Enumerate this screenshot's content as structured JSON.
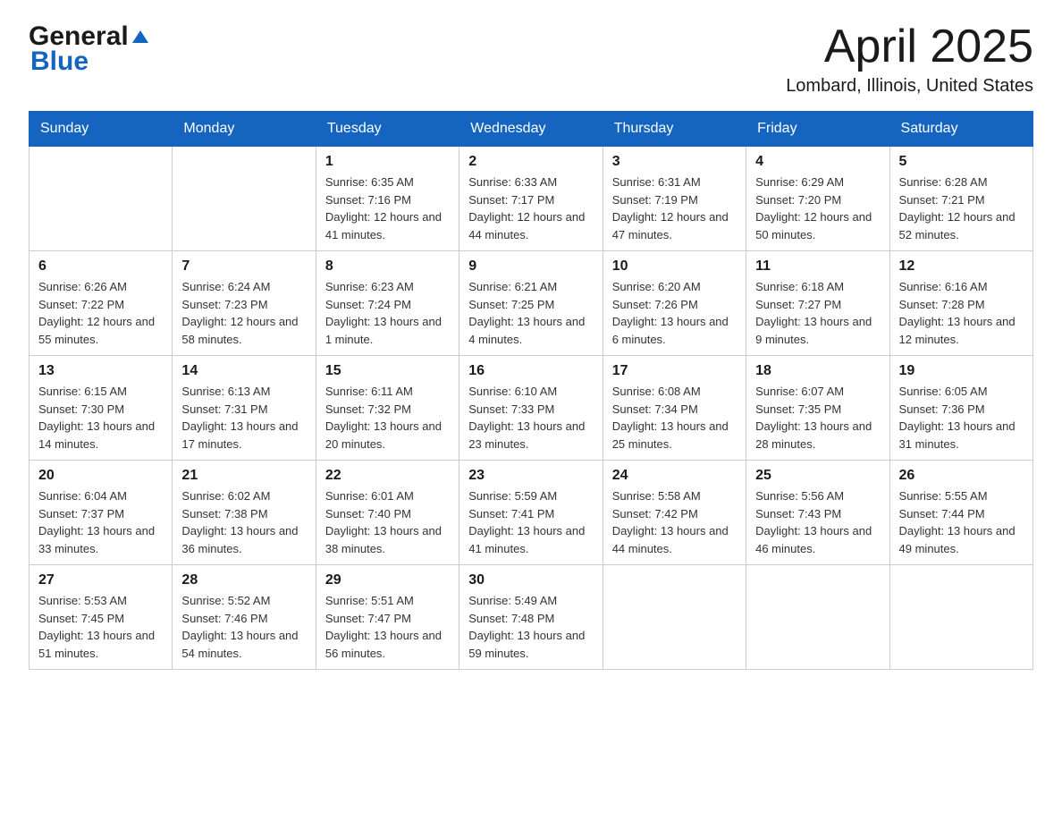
{
  "header": {
    "logo_general": "General",
    "logo_blue": "Blue",
    "month_title": "April 2025",
    "location": "Lombard, Illinois, United States"
  },
  "days_of_week": [
    "Sunday",
    "Monday",
    "Tuesday",
    "Wednesday",
    "Thursday",
    "Friday",
    "Saturday"
  ],
  "weeks": [
    [
      {
        "day": "",
        "sunrise": "",
        "sunset": "",
        "daylight": ""
      },
      {
        "day": "",
        "sunrise": "",
        "sunset": "",
        "daylight": ""
      },
      {
        "day": "1",
        "sunrise": "Sunrise: 6:35 AM",
        "sunset": "Sunset: 7:16 PM",
        "daylight": "Daylight: 12 hours and 41 minutes."
      },
      {
        "day": "2",
        "sunrise": "Sunrise: 6:33 AM",
        "sunset": "Sunset: 7:17 PM",
        "daylight": "Daylight: 12 hours and 44 minutes."
      },
      {
        "day": "3",
        "sunrise": "Sunrise: 6:31 AM",
        "sunset": "Sunset: 7:19 PM",
        "daylight": "Daylight: 12 hours and 47 minutes."
      },
      {
        "day": "4",
        "sunrise": "Sunrise: 6:29 AM",
        "sunset": "Sunset: 7:20 PM",
        "daylight": "Daylight: 12 hours and 50 minutes."
      },
      {
        "day": "5",
        "sunrise": "Sunrise: 6:28 AM",
        "sunset": "Sunset: 7:21 PM",
        "daylight": "Daylight: 12 hours and 52 minutes."
      }
    ],
    [
      {
        "day": "6",
        "sunrise": "Sunrise: 6:26 AM",
        "sunset": "Sunset: 7:22 PM",
        "daylight": "Daylight: 12 hours and 55 minutes."
      },
      {
        "day": "7",
        "sunrise": "Sunrise: 6:24 AM",
        "sunset": "Sunset: 7:23 PM",
        "daylight": "Daylight: 12 hours and 58 minutes."
      },
      {
        "day": "8",
        "sunrise": "Sunrise: 6:23 AM",
        "sunset": "Sunset: 7:24 PM",
        "daylight": "Daylight: 13 hours and 1 minute."
      },
      {
        "day": "9",
        "sunrise": "Sunrise: 6:21 AM",
        "sunset": "Sunset: 7:25 PM",
        "daylight": "Daylight: 13 hours and 4 minutes."
      },
      {
        "day": "10",
        "sunrise": "Sunrise: 6:20 AM",
        "sunset": "Sunset: 7:26 PM",
        "daylight": "Daylight: 13 hours and 6 minutes."
      },
      {
        "day": "11",
        "sunrise": "Sunrise: 6:18 AM",
        "sunset": "Sunset: 7:27 PM",
        "daylight": "Daylight: 13 hours and 9 minutes."
      },
      {
        "day": "12",
        "sunrise": "Sunrise: 6:16 AM",
        "sunset": "Sunset: 7:28 PM",
        "daylight": "Daylight: 13 hours and 12 minutes."
      }
    ],
    [
      {
        "day": "13",
        "sunrise": "Sunrise: 6:15 AM",
        "sunset": "Sunset: 7:30 PM",
        "daylight": "Daylight: 13 hours and 14 minutes."
      },
      {
        "day": "14",
        "sunrise": "Sunrise: 6:13 AM",
        "sunset": "Sunset: 7:31 PM",
        "daylight": "Daylight: 13 hours and 17 minutes."
      },
      {
        "day": "15",
        "sunrise": "Sunrise: 6:11 AM",
        "sunset": "Sunset: 7:32 PM",
        "daylight": "Daylight: 13 hours and 20 minutes."
      },
      {
        "day": "16",
        "sunrise": "Sunrise: 6:10 AM",
        "sunset": "Sunset: 7:33 PM",
        "daylight": "Daylight: 13 hours and 23 minutes."
      },
      {
        "day": "17",
        "sunrise": "Sunrise: 6:08 AM",
        "sunset": "Sunset: 7:34 PM",
        "daylight": "Daylight: 13 hours and 25 minutes."
      },
      {
        "day": "18",
        "sunrise": "Sunrise: 6:07 AM",
        "sunset": "Sunset: 7:35 PM",
        "daylight": "Daylight: 13 hours and 28 minutes."
      },
      {
        "day": "19",
        "sunrise": "Sunrise: 6:05 AM",
        "sunset": "Sunset: 7:36 PM",
        "daylight": "Daylight: 13 hours and 31 minutes."
      }
    ],
    [
      {
        "day": "20",
        "sunrise": "Sunrise: 6:04 AM",
        "sunset": "Sunset: 7:37 PM",
        "daylight": "Daylight: 13 hours and 33 minutes."
      },
      {
        "day": "21",
        "sunrise": "Sunrise: 6:02 AM",
        "sunset": "Sunset: 7:38 PM",
        "daylight": "Daylight: 13 hours and 36 minutes."
      },
      {
        "day": "22",
        "sunrise": "Sunrise: 6:01 AM",
        "sunset": "Sunset: 7:40 PM",
        "daylight": "Daylight: 13 hours and 38 minutes."
      },
      {
        "day": "23",
        "sunrise": "Sunrise: 5:59 AM",
        "sunset": "Sunset: 7:41 PM",
        "daylight": "Daylight: 13 hours and 41 minutes."
      },
      {
        "day": "24",
        "sunrise": "Sunrise: 5:58 AM",
        "sunset": "Sunset: 7:42 PM",
        "daylight": "Daylight: 13 hours and 44 minutes."
      },
      {
        "day": "25",
        "sunrise": "Sunrise: 5:56 AM",
        "sunset": "Sunset: 7:43 PM",
        "daylight": "Daylight: 13 hours and 46 minutes."
      },
      {
        "day": "26",
        "sunrise": "Sunrise: 5:55 AM",
        "sunset": "Sunset: 7:44 PM",
        "daylight": "Daylight: 13 hours and 49 minutes."
      }
    ],
    [
      {
        "day": "27",
        "sunrise": "Sunrise: 5:53 AM",
        "sunset": "Sunset: 7:45 PM",
        "daylight": "Daylight: 13 hours and 51 minutes."
      },
      {
        "day": "28",
        "sunrise": "Sunrise: 5:52 AM",
        "sunset": "Sunset: 7:46 PM",
        "daylight": "Daylight: 13 hours and 54 minutes."
      },
      {
        "day": "29",
        "sunrise": "Sunrise: 5:51 AM",
        "sunset": "Sunset: 7:47 PM",
        "daylight": "Daylight: 13 hours and 56 minutes."
      },
      {
        "day": "30",
        "sunrise": "Sunrise: 5:49 AM",
        "sunset": "Sunset: 7:48 PM",
        "daylight": "Daylight: 13 hours and 59 minutes."
      },
      {
        "day": "",
        "sunrise": "",
        "sunset": "",
        "daylight": ""
      },
      {
        "day": "",
        "sunrise": "",
        "sunset": "",
        "daylight": ""
      },
      {
        "day": "",
        "sunrise": "",
        "sunset": "",
        "daylight": ""
      }
    ]
  ]
}
